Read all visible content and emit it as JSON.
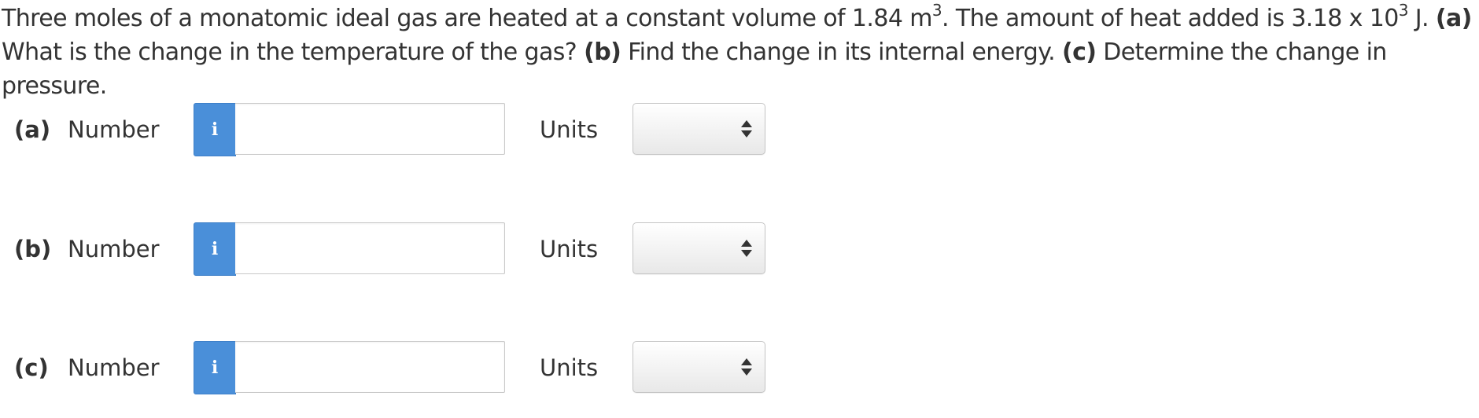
{
  "question": {
    "seg1": "Three moles of a monatomic ideal gas are heated at a constant volume of 1.84 m",
    "sup1": "3",
    "seg2": ". The amount of heat added is 3.18 x 10",
    "sup2": "3",
    "seg3": " J. ",
    "part_a_tag": "(a)",
    "part_a_text": " What is the change in the temperature of the gas? ",
    "part_b_tag": "(b)",
    "part_b_text": " Find the change in its internal energy. ",
    "part_c_tag": "(c)",
    "part_c_text": " Determine the change in pressure."
  },
  "rows": [
    {
      "part_label": "(a)",
      "number_label": "Number",
      "info_icon": "i",
      "number_value": "",
      "units_label": "Units",
      "units_selected": ""
    },
    {
      "part_label": "(b)",
      "number_label": "Number",
      "info_icon": "i",
      "number_value": "",
      "units_label": "Units",
      "units_selected": ""
    },
    {
      "part_label": "(c)",
      "number_label": "Number",
      "info_icon": "i",
      "number_value": "",
      "units_label": "Units",
      "units_selected": ""
    }
  ],
  "colors": {
    "info_button": "#4a8fd9",
    "text": "#333333"
  },
  "icons": {
    "info": "info-icon",
    "select": "up-down-arrows-icon"
  }
}
